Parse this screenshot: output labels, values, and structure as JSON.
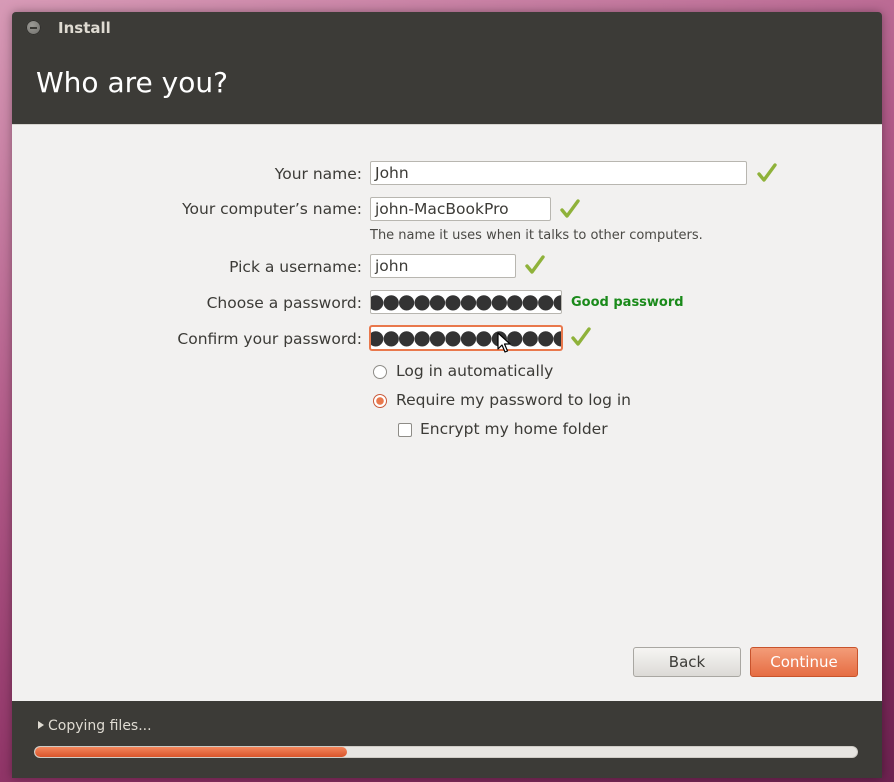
{
  "window": {
    "title": "Install"
  },
  "page": {
    "heading": "Who are you?"
  },
  "form": {
    "name": {
      "label": "Your name:",
      "value": "John",
      "valid": true
    },
    "computer_name": {
      "label": "Your computer’s name:",
      "value": "john-MacBookPro",
      "valid": true,
      "hint": "The name it uses when it talks to other computers."
    },
    "username": {
      "label": "Pick a username:",
      "value": "john",
      "valid": true
    },
    "password": {
      "label": "Choose a password:",
      "masked_value": "●●●●●●●●●●●●●●",
      "strength": "Good password"
    },
    "confirm_password": {
      "label": "Confirm your password:",
      "masked_value": "●●●●●●●●●●●●●●",
      "valid": true
    },
    "login_options": [
      {
        "label": "Log in automatically",
        "selected": false
      },
      {
        "label": "Require my password to log in",
        "selected": true
      }
    ],
    "encrypt_home": {
      "label": "Encrypt my home folder",
      "checked": false
    }
  },
  "buttons": {
    "back": "Back",
    "continue": "Continue"
  },
  "progress": {
    "label": "Copying files...",
    "fraction": 0.38
  },
  "colors": {
    "accent": "#e9784c",
    "check": "#8fb23a",
    "good_password": "#1a8a1a",
    "chrome": "#3c3b37"
  }
}
